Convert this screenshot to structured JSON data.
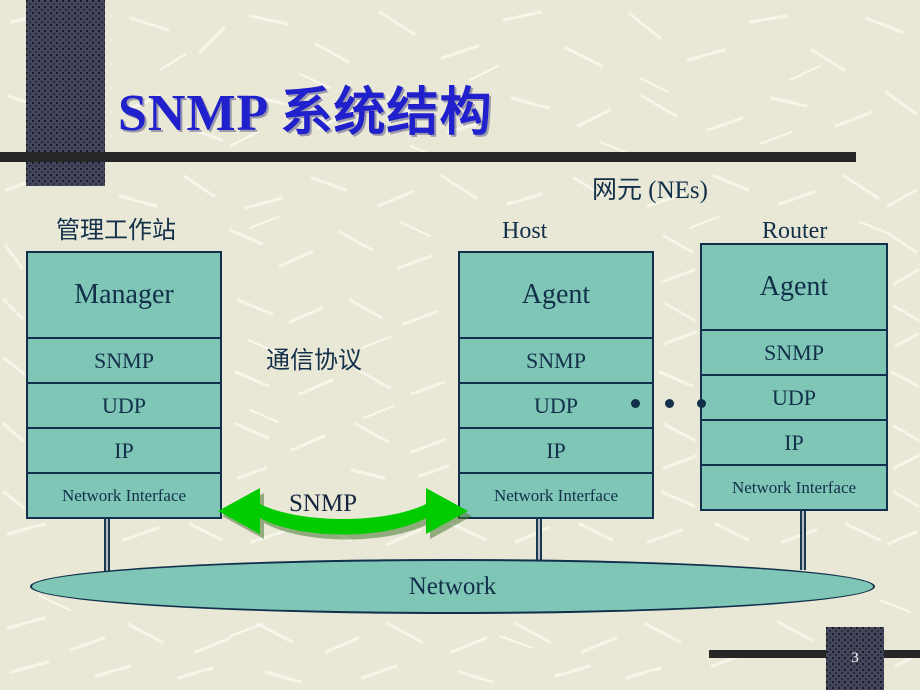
{
  "slide": {
    "title": "SNMP 系统结构",
    "page_number": "3",
    "title_color": "#2020cc",
    "background_color": "#e9e7d6",
    "accent_dark": "#3f4257",
    "box_fill": "#7fc6b6",
    "box_border": "#10304c",
    "arrow_color": "#00cc00"
  },
  "labels": {
    "network_elements": "网元 (NEs)",
    "management_workstation": "管理工作站",
    "host": "Host",
    "router": "Router",
    "communication_protocol": "通信协议",
    "arrow_protocol": "SNMP",
    "network": "Network",
    "ellipsis_dots": [
      "•",
      "•",
      "•"
    ]
  },
  "stacks": [
    {
      "id": "manager",
      "caption": "管理工作站",
      "layers": [
        {
          "label": "Manager",
          "size": "big"
        },
        {
          "label": "SNMP",
          "size": "mid"
        },
        {
          "label": "UDP",
          "size": "mid"
        },
        {
          "label": "IP",
          "size": "mid"
        },
        {
          "label": "Network Interface",
          "size": "small"
        }
      ]
    },
    {
      "id": "host",
      "caption": "Host",
      "layers": [
        {
          "label": "Agent",
          "size": "big"
        },
        {
          "label": "SNMP",
          "size": "mid"
        },
        {
          "label": "UDP",
          "size": "mid"
        },
        {
          "label": "IP",
          "size": "mid"
        },
        {
          "label": "Network Interface",
          "size": "small"
        }
      ]
    },
    {
      "id": "router",
      "caption": "Router",
      "layers": [
        {
          "label": "Agent",
          "size": "big"
        },
        {
          "label": "SNMP",
          "size": "mid"
        },
        {
          "label": "UDP",
          "size": "mid"
        },
        {
          "label": "IP",
          "size": "mid"
        },
        {
          "label": "Network Interface",
          "size": "small"
        }
      ]
    }
  ]
}
